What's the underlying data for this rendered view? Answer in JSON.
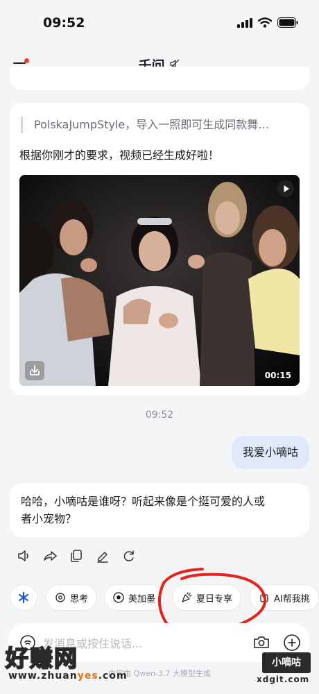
{
  "status_bar": {
    "time": "09:52"
  },
  "nav": {
    "title": "千问"
  },
  "card": {
    "quote": "PolskaJumpStyle，导入一照即可生成同款舞…",
    "reply": "根据你刚才的要求，视频已经生成好啦！",
    "video": {
      "duration": "00:15"
    }
  },
  "timestamp": "09:52",
  "user_message": "我爱小嘀咕",
  "ai_reply": {
    "line1": "哈哈，小嘀咕是谁呀？听起来像是个挺可爱的人或",
    "line2": "者小宠物？"
  },
  "chips": {
    "think": "思考",
    "mexico": "美加墨",
    "summer": "夏日专享",
    "ai_help": "AI帮我挑"
  },
  "input": {
    "placeholder": "发消息或按住说话...",
    "footer": "内容由 Qwen-3.7 大模型生成"
  },
  "watermark": {
    "site_name": "好赚网",
    "url_prefix": "www.zhuan",
    "url_highlight": "yes",
    "url_suffix": ".com",
    "badge": "小嘀咕",
    "domain": "xdgit.com"
  }
}
